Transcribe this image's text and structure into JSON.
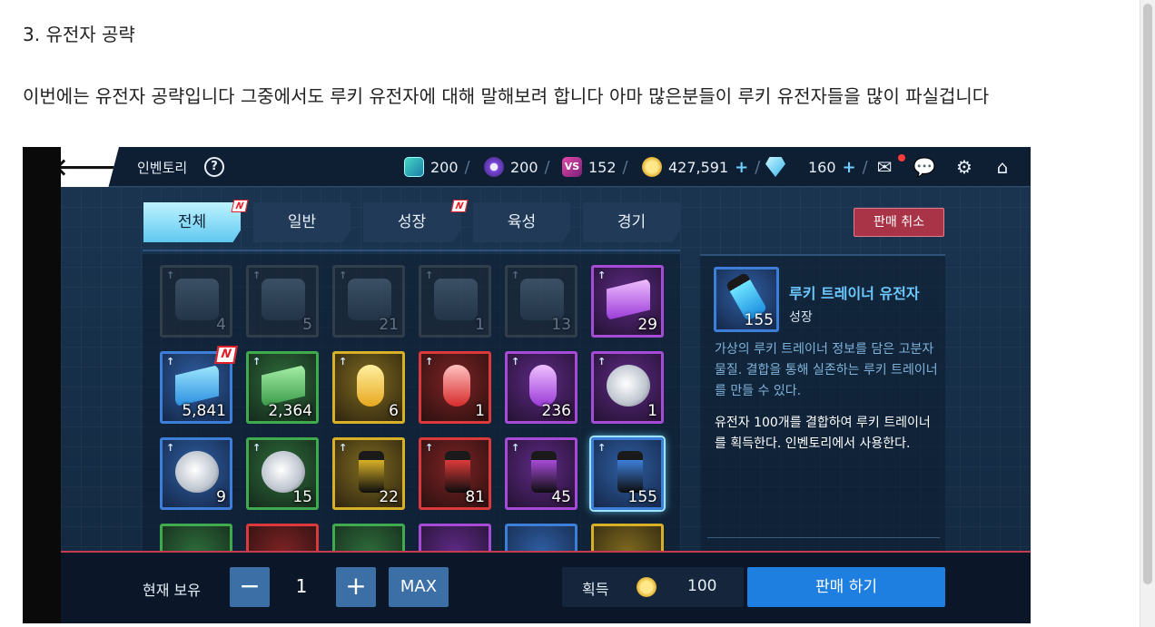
{
  "article": {
    "heading": "3. 유전자 공략",
    "paragraph": "이번에는 유전자 공략입니다 그중에서도 루키 유전자에 대해 말해보려 합니다 아마 많은분들이 루키 유전자들을 많이 파실겁니다"
  },
  "game": {
    "topbar": {
      "title": "인벤토리",
      "help": "?",
      "res1": "200",
      "res2": "200",
      "res3": "152",
      "res3_icon": "VS",
      "gold": "427,591",
      "gems": "160",
      "plus": "+",
      "sep": "/",
      "back": "🡐",
      "mail": "✉",
      "chat": "💬",
      "settings": "⚙",
      "home": "⌂"
    },
    "tabs": [
      {
        "label": "전체",
        "badge": "N"
      },
      {
        "label": "일반"
      },
      {
        "label": "성장",
        "badge": "N"
      },
      {
        "label": "육성"
      },
      {
        "label": "경기"
      }
    ],
    "cancel_sell": "판매 취소",
    "items": [
      {
        "count": "4",
        "color": "gray",
        "art": "box",
        "dim": true
      },
      {
        "count": "5",
        "color": "gray",
        "art": "box",
        "dim": true
      },
      {
        "count": "21",
        "color": "gray",
        "art": "max",
        "dim": true
      },
      {
        "count": "1",
        "color": "gray",
        "art": "vs",
        "dim": true
      },
      {
        "count": "13",
        "color": "gray",
        "art": "max",
        "dim": true
      },
      {
        "count": "29",
        "color": "purple",
        "art": "chip"
      },
      {
        "count": "5,841",
        "color": "blue",
        "art": "chip",
        "new": "N"
      },
      {
        "count": "2,364",
        "color": "green",
        "art": "chip"
      },
      {
        "count": "6",
        "color": "yellow",
        "art": "capsule"
      },
      {
        "count": "1",
        "color": "red",
        "art": "capsule"
      },
      {
        "count": "236",
        "color": "purple",
        "art": "capsule"
      },
      {
        "count": "1",
        "color": "purple",
        "art": "head"
      },
      {
        "count": "9",
        "color": "blue",
        "art": "head"
      },
      {
        "count": "15",
        "color": "green",
        "art": "head"
      },
      {
        "count": "22",
        "color": "yellow",
        "art": "tube"
      },
      {
        "count": "81",
        "color": "red",
        "art": "tube"
      },
      {
        "count": "45",
        "color": "purple",
        "art": "tube"
      },
      {
        "count": "155",
        "color": "blue",
        "art": "tube",
        "selected": true
      }
    ],
    "detail": {
      "name": "루키 트레이너 유전자",
      "category": "성장",
      "count": "155",
      "description": "가상의 루키 트레이너 정보를 담은 고분자 물질. 결합을 통해 실존하는 루키 트레이너를 만들 수 있다.",
      "note": "유전자 100개를 결합하여 루키 트레이너를 획득한다. 인벤토리에서 사용한다."
    },
    "bottom": {
      "hold_label": "현재 보유",
      "minus": "−",
      "quantity": "1",
      "plus": "+",
      "max": "MAX",
      "gain_label": "획득",
      "gain_value": "100",
      "sell": "판매 하기"
    }
  },
  "colors": {
    "gray": "#6d6d6d",
    "blue": "#3d7ed8",
    "green": "#3faa4e",
    "yellow": "#d8b028",
    "red": "#dc3a3a",
    "purple": "#a64ad8"
  }
}
